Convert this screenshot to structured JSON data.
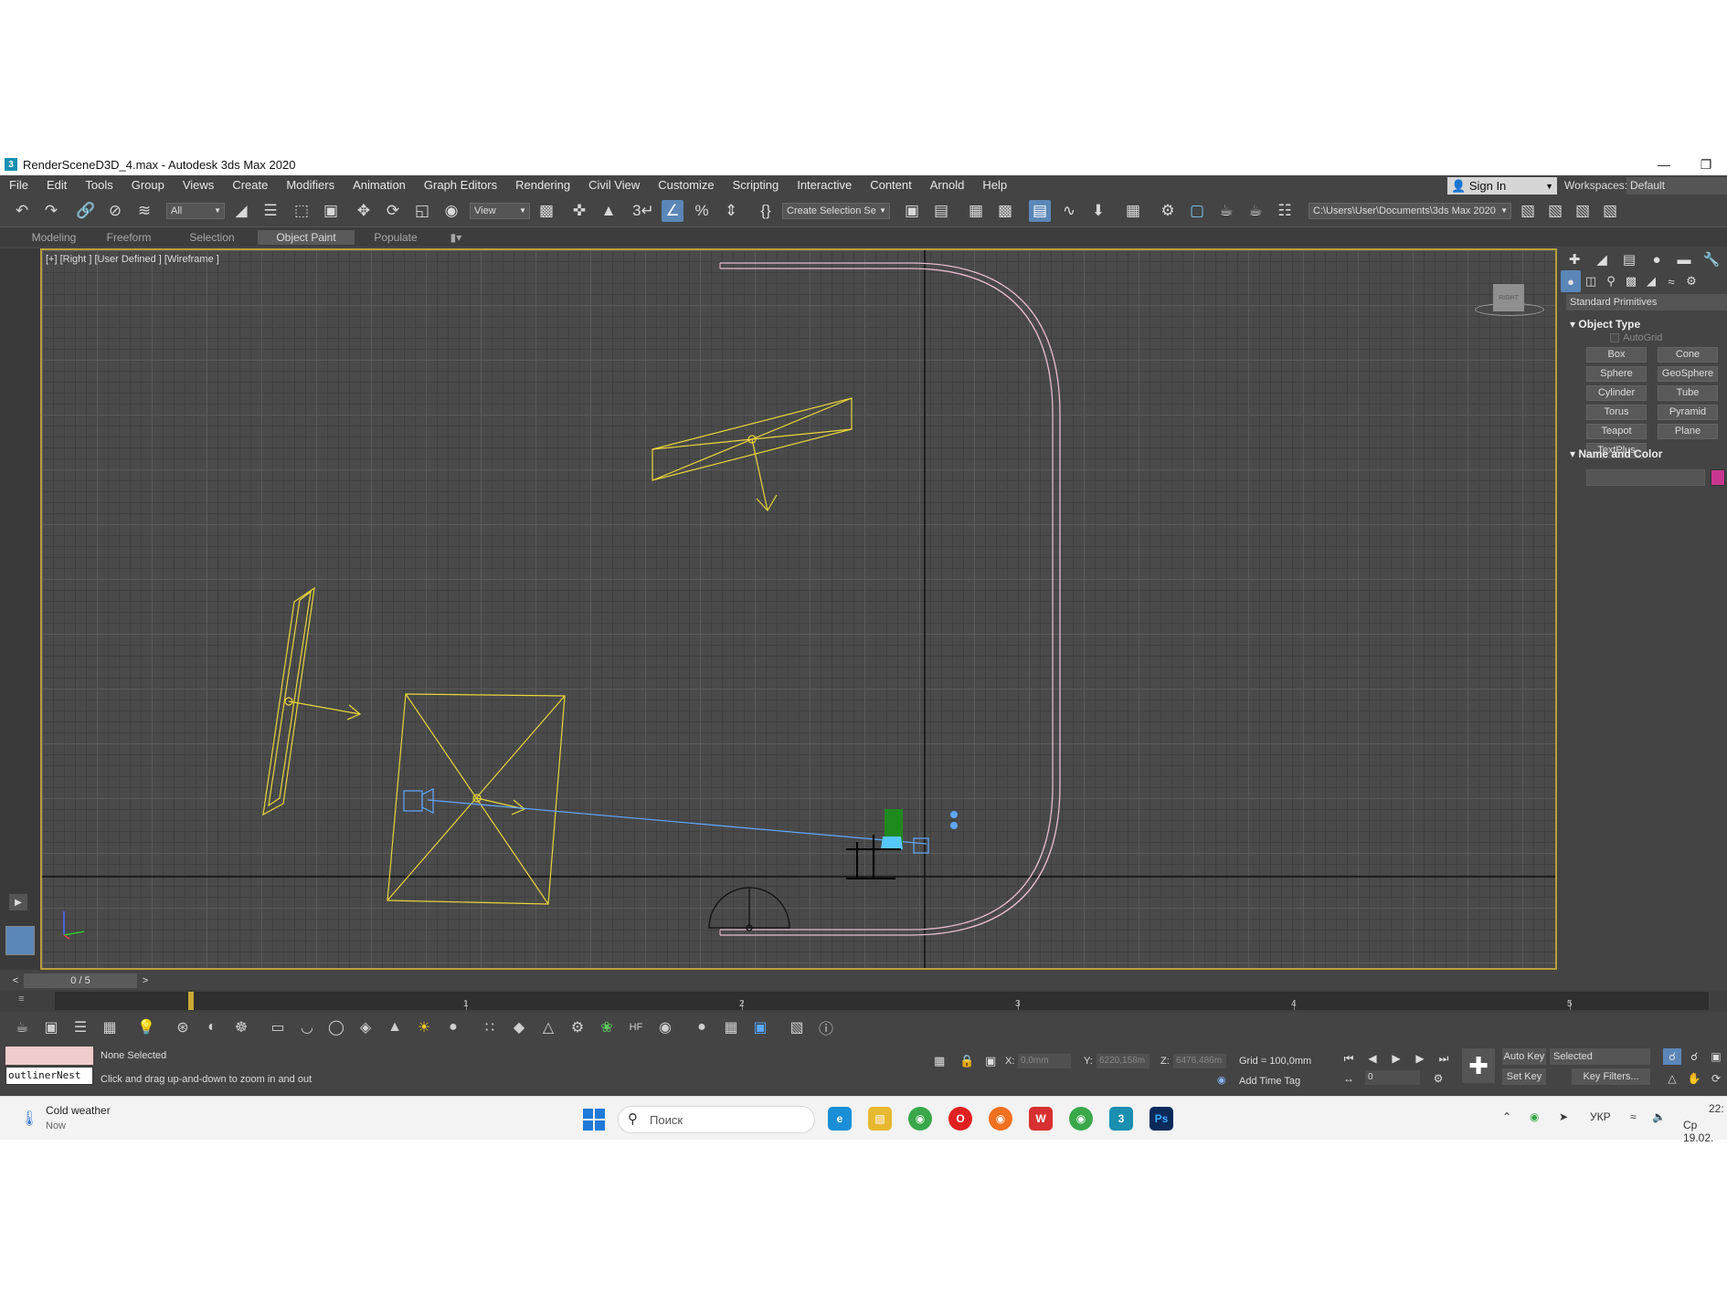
{
  "window": {
    "title": "RenderSceneD3D_4.max - Autodesk 3ds Max 2020",
    "app_icon_label": "3",
    "minimize_icon": "minimize-icon",
    "restore_icon": "restore-icon"
  },
  "menu": [
    "File",
    "Edit",
    "Tools",
    "Group",
    "Views",
    "Create",
    "Modifiers",
    "Animation",
    "Graph Editors",
    "Rendering",
    "Civil View",
    "Customize",
    "Scripting",
    "Interactive",
    "Content",
    "Arnold",
    "Help"
  ],
  "account": {
    "sign_in": "Sign In",
    "workspaces_label": "Workspaces:",
    "workspace": "Default"
  },
  "toolbar": {
    "selection_filter": "All",
    "ref_coord": "View",
    "named_selection": "Create Selection Se",
    "project_path": "C:\\Users\\User\\Documents\\3ds Max 2020"
  },
  "ribbon": {
    "tabs": [
      "Modeling",
      "Freeform",
      "Selection",
      "Object Paint",
      "Populate"
    ],
    "selected": "Object Paint"
  },
  "viewport": {
    "label": "[+] [Right ] [User Defined ] [Wireframe ]",
    "viewcube_label": "RIGHT"
  },
  "command_panel": {
    "category": "Standard Primitives",
    "object_type_title": "Object Type",
    "autogrid": "AutoGrid",
    "primitives": [
      "Box",
      "Cone",
      "Sphere",
      "GeoSphere",
      "Cylinder",
      "Tube",
      "Torus",
      "Pyramid",
      "Teapot",
      "Plane",
      "TextPlus"
    ],
    "name_color_title": "Name and Color",
    "object_color": "#c8378e"
  },
  "timeline": {
    "slider": "0 / 5",
    "ticks": [
      "1",
      "2",
      "3",
      "4",
      "5"
    ],
    "prev_arrow": "<",
    "next_arrow": ">"
  },
  "status": {
    "maxscript_input": "outlinerNest",
    "selection": "None Selected",
    "prompt": "Click and drag up-and-down to zoom in and out",
    "x_label": "X:",
    "x_value": "0,0mm",
    "y_label": "Y:",
    "y_value": "6220,158m",
    "z_label": "Z:",
    "z_value": "6476,486m",
    "grid": "Grid = 100,0mm",
    "add_time_tag": "Add Time Tag",
    "frame": "0",
    "auto_key": "Auto Key",
    "set_key": "Set Key",
    "key_mode": "Selected",
    "key_filters": "Key Filters..."
  },
  "taskbar": {
    "weather_title": "Cold weather",
    "weather_sub": "Now",
    "search_placeholder": "Поиск",
    "lang": "УКР",
    "time": "22:",
    "date": "Ср 19.02."
  },
  "colors": {
    "light_wire": "#e8d63a",
    "camera_target": "#5fa8ff",
    "curve": "#e8bcd0",
    "selection_border": "#b7a03a"
  }
}
